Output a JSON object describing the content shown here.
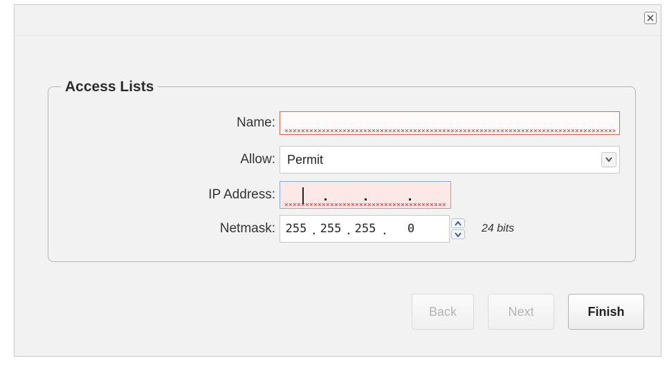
{
  "dialog": {
    "close_icon": "close-icon"
  },
  "section": {
    "legend": "Access Lists"
  },
  "form": {
    "name": {
      "label": "Name:",
      "value": ""
    },
    "allow": {
      "label": "Allow:",
      "value": "Permit"
    },
    "ip": {
      "label": "IP Address:",
      "octets": [
        "",
        "",
        "",
        ""
      ]
    },
    "netmask": {
      "label": "Netmask:",
      "octets": [
        "255",
        "255",
        "255",
        "0"
      ],
      "bits": "24 bits"
    }
  },
  "buttons": {
    "back": "Back",
    "next": "Next",
    "finish": "Finish"
  },
  "colors": {
    "error_border": "#d96a4b",
    "error_fill": "#fde8e8",
    "focus_border": "#8aa9d8"
  }
}
